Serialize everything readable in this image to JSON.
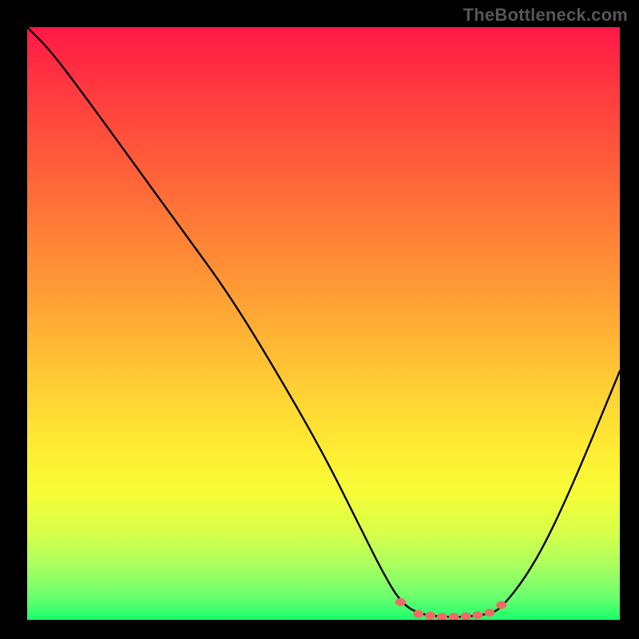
{
  "watermark": "TheBottleneck.com",
  "colors": {
    "background": "#000000",
    "curve": "#000000",
    "marker_stroke": "#f06a66",
    "marker_fill": "#f06a66"
  },
  "chart_data": {
    "type": "line",
    "title": "",
    "xlabel": "",
    "ylabel": "",
    "xlim": [
      0,
      100
    ],
    "ylim": [
      0,
      100
    ],
    "curve": [
      {
        "x": 0,
        "y": 100
      },
      {
        "x": 4,
        "y": 96
      },
      {
        "x": 10,
        "y": 88
      },
      {
        "x": 18,
        "y": 77
      },
      {
        "x": 26,
        "y": 66
      },
      {
        "x": 34,
        "y": 55
      },
      {
        "x": 42,
        "y": 42
      },
      {
        "x": 50,
        "y": 28
      },
      {
        "x": 56,
        "y": 16
      },
      {
        "x": 60,
        "y": 8
      },
      {
        "x": 63,
        "y": 3
      },
      {
        "x": 66,
        "y": 1
      },
      {
        "x": 70,
        "y": 0.5
      },
      {
        "x": 74,
        "y": 0.5
      },
      {
        "x": 78,
        "y": 1
      },
      {
        "x": 80,
        "y": 2
      },
      {
        "x": 84,
        "y": 7
      },
      {
        "x": 88,
        "y": 14
      },
      {
        "x": 93,
        "y": 25
      },
      {
        "x": 100,
        "y": 42
      }
    ],
    "markers": [
      {
        "x": 63,
        "y": 3
      },
      {
        "x": 66,
        "y": 1
      },
      {
        "x": 68,
        "y": 0.7
      },
      {
        "x": 70,
        "y": 0.5
      },
      {
        "x": 72,
        "y": 0.5
      },
      {
        "x": 74,
        "y": 0.6
      },
      {
        "x": 76,
        "y": 0.8
      },
      {
        "x": 78,
        "y": 1.2
      },
      {
        "x": 80,
        "y": 2.5
      }
    ],
    "marker_note": "salmon dots along the flat bottom of the V-curve"
  }
}
